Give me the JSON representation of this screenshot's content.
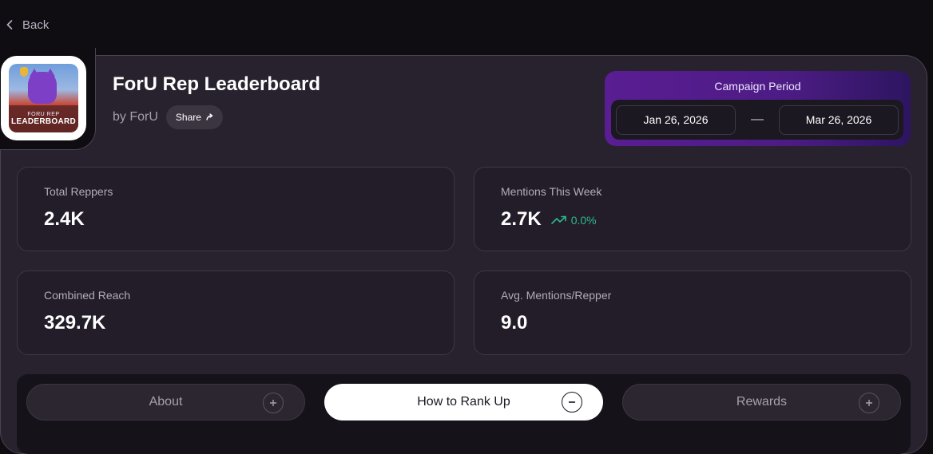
{
  "nav": {
    "back_label": "Back"
  },
  "header": {
    "title": "ForU Rep Leaderboard",
    "byline": "by ForU",
    "share_label": "Share",
    "logo": {
      "top_text": "FORU REP",
      "main_text": "LEADERBOARD"
    }
  },
  "campaign": {
    "title": "Campaign Period",
    "start_date": "Jan 26, 2026",
    "separator": "—",
    "end_date": "Mar 26, 2026"
  },
  "stats": [
    {
      "label": "Total Reppers",
      "value": "2.4K"
    },
    {
      "label": "Mentions This Week",
      "value": "2.7K",
      "trend": "0.0%",
      "trend_color": "#2fb88e"
    },
    {
      "label": "Combined Reach",
      "value": "329.7K"
    },
    {
      "label": "Avg. Mentions/Repper",
      "value": "9.0"
    }
  ],
  "tabs": [
    {
      "label": "About",
      "state": "collapsed"
    },
    {
      "label": "How to Rank Up",
      "state": "expanded"
    },
    {
      "label": "Rewards",
      "state": "collapsed"
    }
  ],
  "colors": {
    "accent_purple": "#5a1d93",
    "positive": "#2fb88e",
    "background": "#0f0c12",
    "card": "#28222f"
  }
}
